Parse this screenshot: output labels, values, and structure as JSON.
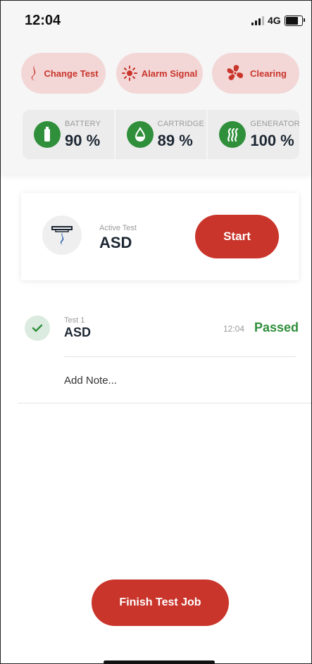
{
  "status_bar": {
    "time": "12:04",
    "network": "4G"
  },
  "actions": [
    {
      "label": "Change Test",
      "icon": "flame-icon"
    },
    {
      "label": "Alarm Signal",
      "icon": "alarm-light-icon"
    },
    {
      "label": "Clearing",
      "icon": "fan-icon"
    }
  ],
  "stats": [
    {
      "label": "BATTERY",
      "value": "90 %",
      "icon": "battery-icon"
    },
    {
      "label": "CARTRIDGE",
      "value": "89 %",
      "icon": "drop-icon"
    },
    {
      "label": "GENERATOR",
      "value": "100 %",
      "icon": "smoke-icon"
    }
  ],
  "active_test": {
    "caption": "Active Test",
    "name": "ASD",
    "start_label": "Start",
    "icon": "detector-icon"
  },
  "results": [
    {
      "caption": "Test 1",
      "name": "ASD",
      "time": "12:04",
      "status": "Passed"
    }
  ],
  "add_note_label": "Add Note...",
  "finish_label": "Finish Test Job",
  "colors": {
    "accent": "#c9352b",
    "accent_light": "#f3d7d7",
    "success": "#2f8f3a"
  }
}
